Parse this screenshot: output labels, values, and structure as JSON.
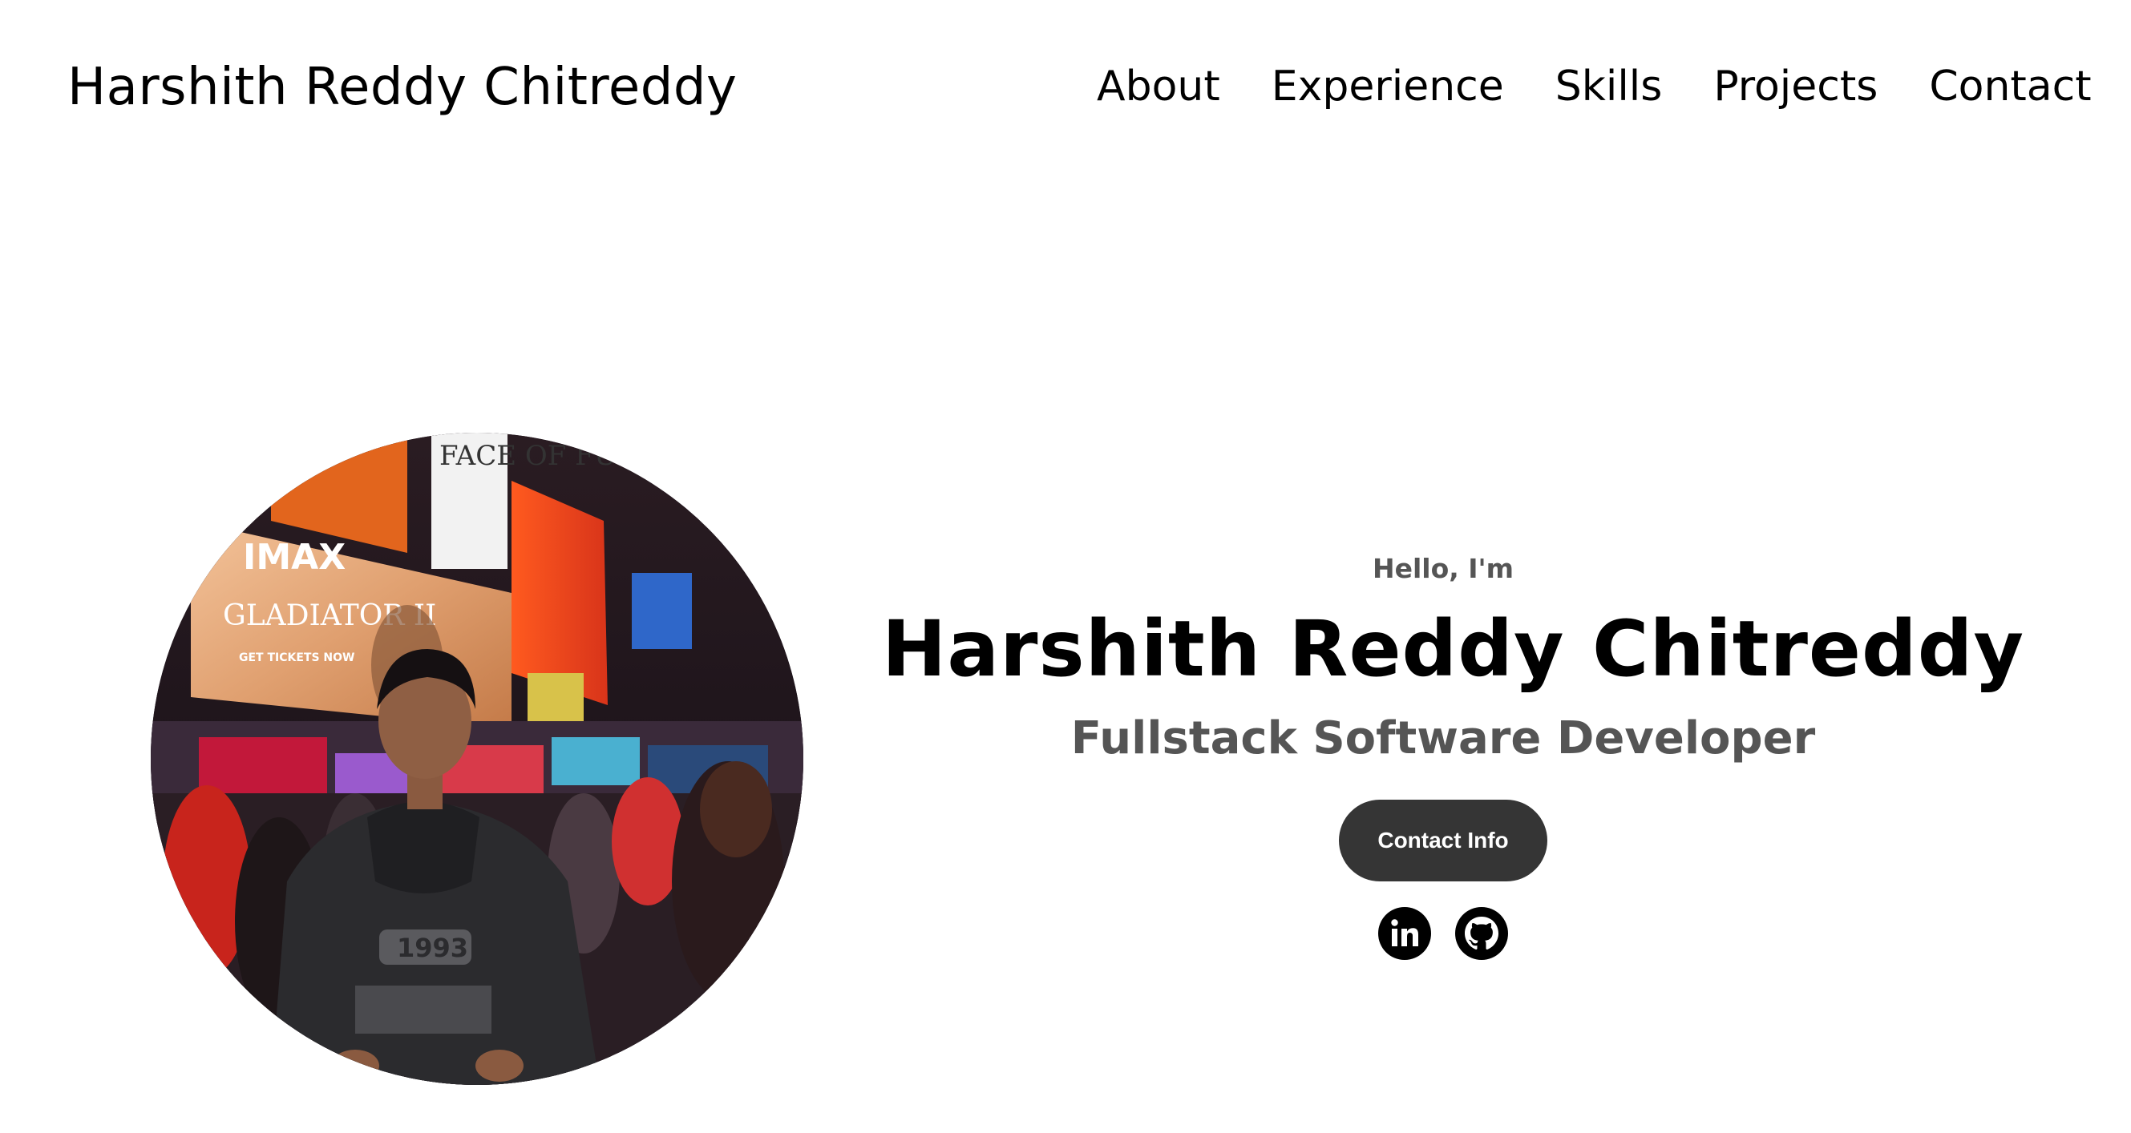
{
  "header": {
    "site_name": "Harshith Reddy Chitreddy",
    "nav": [
      {
        "label": "About"
      },
      {
        "label": "Experience"
      },
      {
        "label": "Skills"
      },
      {
        "label": "Projects"
      },
      {
        "label": "Contact"
      }
    ]
  },
  "hero": {
    "greeting": "Hello, I'm",
    "name": "Harshith Reddy Chitreddy",
    "role": "Fullstack Software Developer",
    "contact_button_label": "Contact Info",
    "social_links": [
      {
        "icon": "linkedin-icon"
      },
      {
        "icon": "github-icon"
      }
    ]
  },
  "photo": {
    "billboard_text": [
      "IMAX",
      "GLADIATOR II",
      "GET TICKETS NOW",
      "FACE OF FUT"
    ],
    "hoodie_text": "1993"
  },
  "colors": {
    "background": "#ffffff",
    "text_primary": "#000000",
    "text_secondary": "#555555",
    "button_bg": "#353535",
    "button_text": "#ffffff"
  }
}
